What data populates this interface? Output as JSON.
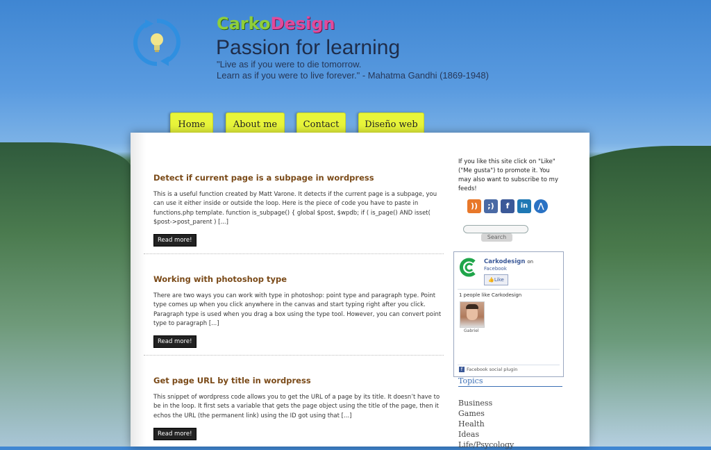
{
  "site": {
    "brand_part1": "Carko",
    "brand_part2": "Design",
    "tagline": "Passion for learning",
    "quote_line1": "\"Live as if you were to die tomorrow.",
    "quote_line2": "Learn as if you were to live forever.\" - Mahatma Gandhi  (1869-1948)"
  },
  "nav": [
    {
      "label": "Home"
    },
    {
      "label": "About me"
    },
    {
      "label": "Contact"
    },
    {
      "label": "Diseño web"
    }
  ],
  "posts": [
    {
      "title": "Detect if current page is a subpage in wordpress",
      "excerpt": "This is a useful function created by Matt Varone. It detects if the current page is a subpage, you can use it either inside or outside the loop. Here is the piece of code you have to paste in functions.php template. function is_subpage() {  global $post, $wpdb;    if ( is_page() AND isset( $post->post_parent ) [...]",
      "read_more": "Read more!"
    },
    {
      "title": "Working with photoshop type",
      "excerpt": "There are two ways you can work with type in photoshop: point type and paragraph type. Point type comes up when you click anywhere in the canvas and start typing right after you click. Paragraph type is used when you drag a box using the type tool. However, you can convert point type to paragraph [...]",
      "read_more": "Read more!"
    },
    {
      "title": "Get page URL by title in wordpress",
      "excerpt": "This snippet of wordpress code allows you to get the URL of a page by its title. It doesn’t have to be in the loop. It first sets a variable that gets the page object using the title of the page, then it echos the URL (the permanent link) using the ID got using that [...]",
      "read_more": "Read more!"
    }
  ],
  "sidebar": {
    "intro": "If you like this site click on \"Like\" (\"Me gusta\") to promote it. You may also want to subscribe to my feeds!",
    "icons": [
      {
        "name": "rss-icon",
        "glyph": "))",
        "color": "#e8782a"
      },
      {
        "name": "smiley-icon",
        "glyph": ";)",
        "color": "#4a6aa5"
      },
      {
        "name": "facebook-icon",
        "glyph": "f",
        "color": "#3b5998"
      },
      {
        "name": "linkedin-icon",
        "glyph": "in",
        "color": "#1f78b4"
      },
      {
        "name": "arrow-icon",
        "glyph": "⋀",
        "color": "#2a72c4"
      }
    ],
    "search_button": "Search",
    "facebook": {
      "page_name": "Carkodesign",
      "on": "on",
      "platform": "Facebook",
      "like_label": "Like",
      "count_text": "1 people like Carkodesign",
      "fan_name": "Gabriel",
      "footer": "Facebook social plugin"
    },
    "topics_title": "Topics",
    "topics": [
      "Business",
      "Games",
      "Health",
      "Ideas",
      "Life/Psycology"
    ]
  }
}
